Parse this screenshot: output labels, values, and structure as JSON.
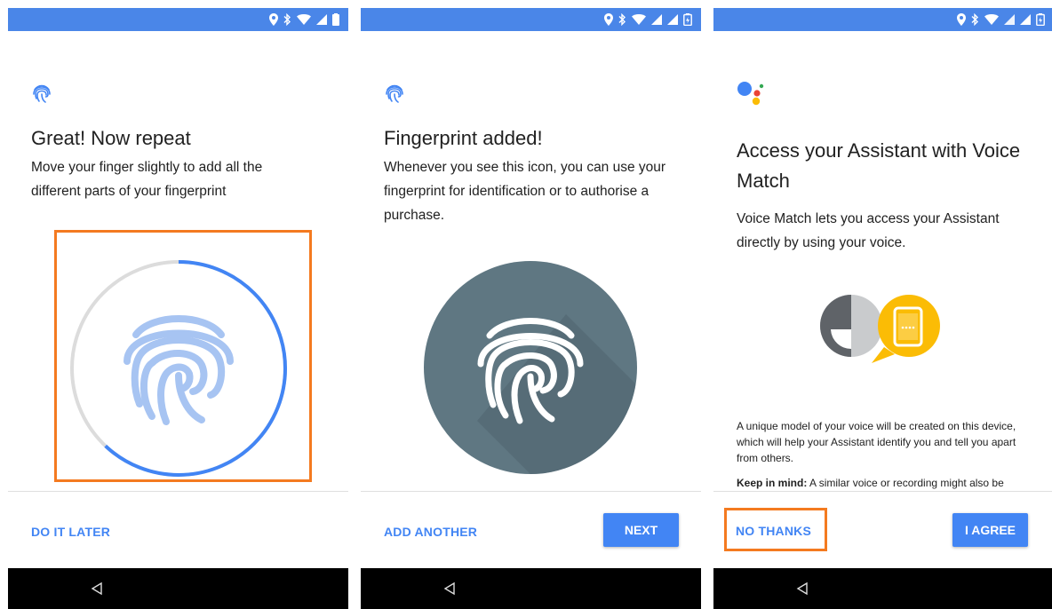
{
  "colors": {
    "statusbar": "#4a86e8",
    "accent": "#4285f4",
    "highlight": "#f47a20",
    "fingerprint_light": "#a7c4f2",
    "progress_ring": "#4285f4",
    "ring_track": "#dcdcdc",
    "fp_circle": "#5f7782"
  },
  "screens": [
    {
      "title": "Great! Now repeat",
      "body": "Move your finger slightly to add all the different parts of your fingerprint",
      "progress": 0.62,
      "buttons": {
        "left": "DO IT LATER"
      }
    },
    {
      "title": "Fingerprint added!",
      "body": "Whenever you see this icon, you can use your fingerprint for identification or to authorise a purchase.",
      "buttons": {
        "left": "ADD ANOTHER",
        "right": "NEXT"
      }
    },
    {
      "title": "Access your Assistant with Voice Match",
      "body": "Voice Match lets you access your Assistant directly by using your voice.",
      "fine_print": "A unique model of your voice will be created on this device, which will help your Assistant identify you and tell you apart from others.",
      "keep_in_mind_label": "Keep in mind:",
      "keep_in_mind_text": " A similar voice or recording might also be",
      "buttons": {
        "left": "NO THANKS",
        "right": "I AGREE"
      }
    }
  ],
  "icons": {
    "status": [
      "location-icon",
      "bluetooth-icon",
      "wifi-icon",
      "signal-icon",
      "battery-icon"
    ],
    "nav": "back-icon"
  }
}
